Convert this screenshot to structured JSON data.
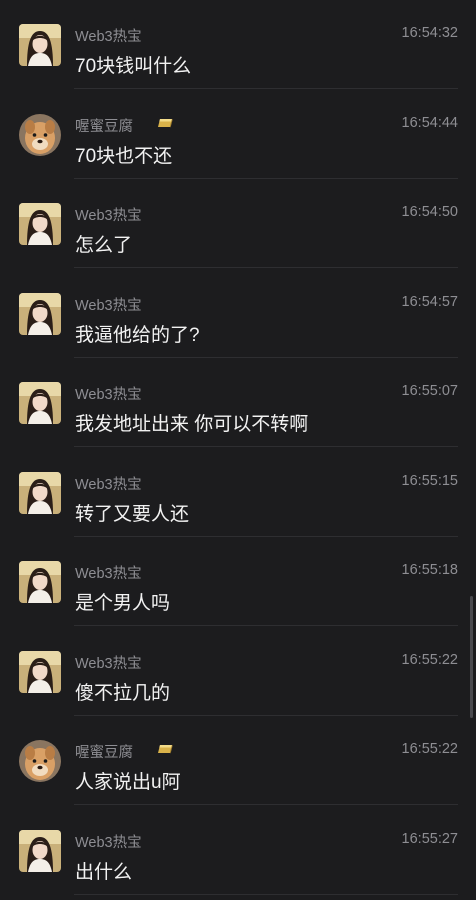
{
  "messages": [
    {
      "sender": "Web3热宝",
      "avatar": "girl-avatar",
      "time": "16:54:32",
      "text": "70块钱叫什么",
      "badge": false
    },
    {
      "sender": "喔蜜豆腐",
      "avatar": "dog-avatar",
      "time": "16:54:44",
      "text": "70块也不还",
      "badge": true
    },
    {
      "sender": "Web3热宝",
      "avatar": "girl-avatar",
      "time": "16:54:50",
      "text": "怎么了",
      "badge": false
    },
    {
      "sender": "Web3热宝",
      "avatar": "girl-avatar",
      "time": "16:54:57",
      "text": "我逼他给的了?",
      "badge": false
    },
    {
      "sender": "Web3热宝",
      "avatar": "girl-avatar",
      "time": "16:55:07",
      "text": "我发地址出来 你可以不转啊",
      "badge": false
    },
    {
      "sender": "Web3热宝",
      "avatar": "girl-avatar",
      "time": "16:55:15",
      "text": "转了又要人还",
      "badge": false
    },
    {
      "sender": "Web3热宝",
      "avatar": "girl-avatar",
      "time": "16:55:18",
      "text": "是个男人吗",
      "badge": false
    },
    {
      "sender": "Web3热宝",
      "avatar": "girl-avatar",
      "time": "16:55:22",
      "text": "傻不拉几的",
      "badge": false
    },
    {
      "sender": "喔蜜豆腐",
      "avatar": "dog-avatar",
      "time": "16:55:22",
      "text": "人家说出u阿",
      "badge": true
    },
    {
      "sender": "Web3热宝",
      "avatar": "girl-avatar",
      "time": "16:55:27",
      "text": "出什么",
      "badge": false
    }
  ],
  "colors": {
    "background": "#1c1c1e",
    "name_text": "#8e8e93",
    "message_text": "#f2f2f2",
    "badge_gold": "#d9b24a"
  },
  "badge_icon": "gold-bar-icon"
}
